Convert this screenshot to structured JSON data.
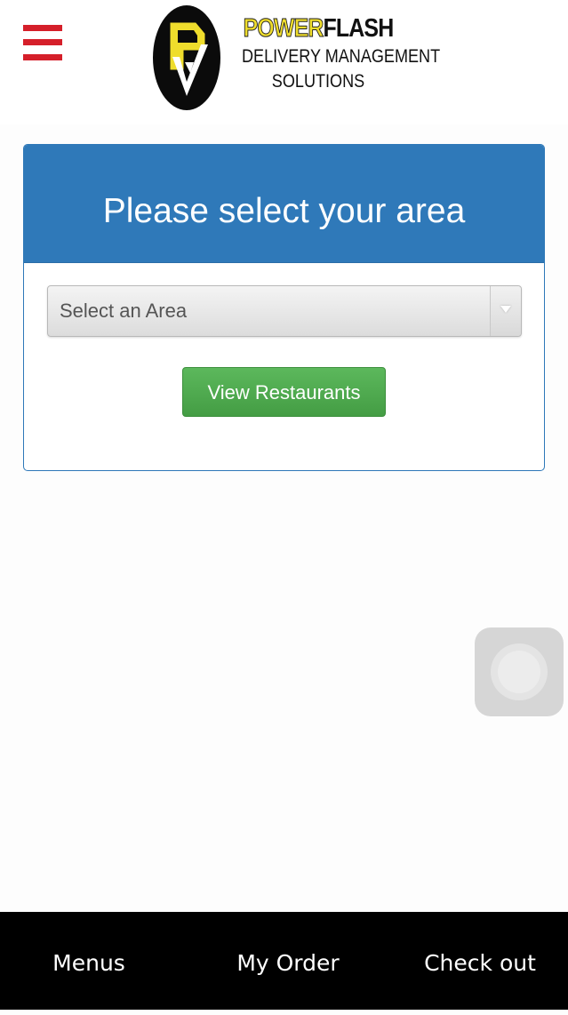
{
  "header": {
    "logo": {
      "brand_part1": "POWER",
      "brand_part2": "FLASH",
      "subtitle_line1": "DELIVERY MANAGEMENT",
      "subtitle_line2": "SOLUTIONS",
      "mark_letters": "PF"
    },
    "menu_icon": "hamburger-menu-icon"
  },
  "panel": {
    "title": "Please select your area",
    "select": {
      "value": "Select an Area",
      "icon": "dropdown-arrow-icon"
    },
    "button_label": "View Restaurants"
  },
  "bottom_nav": {
    "items": [
      {
        "label": "Menus"
      },
      {
        "label": "My Order"
      },
      {
        "label": "Check out"
      }
    ]
  },
  "colors": {
    "menu_icon": "#d51f2a",
    "panel_header": "#2f79b9",
    "button": "#5cb85c",
    "nav_background": "#000000",
    "logo_yellow": "#efdd2c"
  }
}
